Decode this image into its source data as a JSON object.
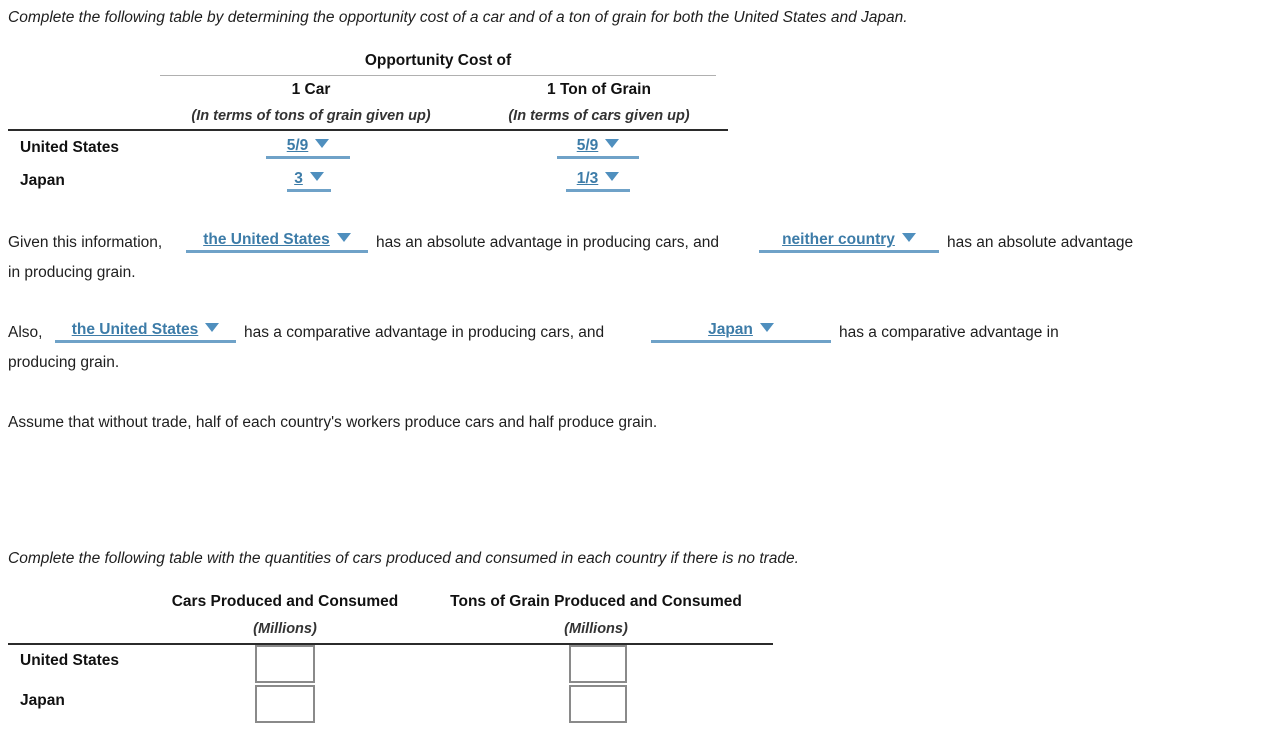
{
  "colors": {
    "accent_blue": "#3d7ca8",
    "accent_blue_underline": "#6fa2c8",
    "rule_dark": "#2b2b2b",
    "rule_light": "#b0b0b0",
    "box_border": "#8a8a8a",
    "text": "#1e1e1e"
  },
  "prompt1": "Complete the following table by determining the opportunity cost of a car and of a ton of grain for both the United States and Japan.",
  "table1": {
    "spanning_header": "Opportunity Cost of",
    "columns": [
      {
        "title": "1 Car",
        "subtitle": "(In terms of tons of grain given up)"
      },
      {
        "title": "1 Ton of Grain",
        "subtitle": "(In terms of cars given up)"
      }
    ],
    "rows": [
      {
        "label": "United States",
        "car_cost": "5/9",
        "grain_cost": "5/9"
      },
      {
        "label": "Japan",
        "car_cost": "3",
        "grain_cost": "1/3"
      }
    ]
  },
  "paragraph_absolute": {
    "part1": "Given this information,",
    "dropdown1": "the United States",
    "part2": "has an absolute advantage in producing cars, and",
    "dropdown2": "neither country",
    "part3": "has an absolute advantage",
    "part4": "in producing grain."
  },
  "paragraph_comparative": {
    "part1": "Also,",
    "dropdown1": "the United States",
    "part2": "has a comparative advantage in producing cars, and",
    "dropdown2": "Japan",
    "part3": "has a comparative advantage in",
    "part4": "producing grain."
  },
  "assumption": "Assume that without trade, half of each country's workers produce cars and half produce grain.",
  "prompt2": "Complete the following table with the quantities of cars produced and consumed in each country if there is no trade.",
  "table2": {
    "columns": [
      {
        "title": "Cars Produced and Consumed",
        "subtitle": "(Millions)"
      },
      {
        "title": "Tons of Grain Produced and Consumed",
        "subtitle": "(Millions)"
      }
    ],
    "rows": [
      {
        "label": "United States",
        "cars": "",
        "grain": ""
      },
      {
        "label": "Japan",
        "cars": "",
        "grain": ""
      }
    ]
  },
  "icons": {
    "caret": "chevron-down-icon"
  }
}
